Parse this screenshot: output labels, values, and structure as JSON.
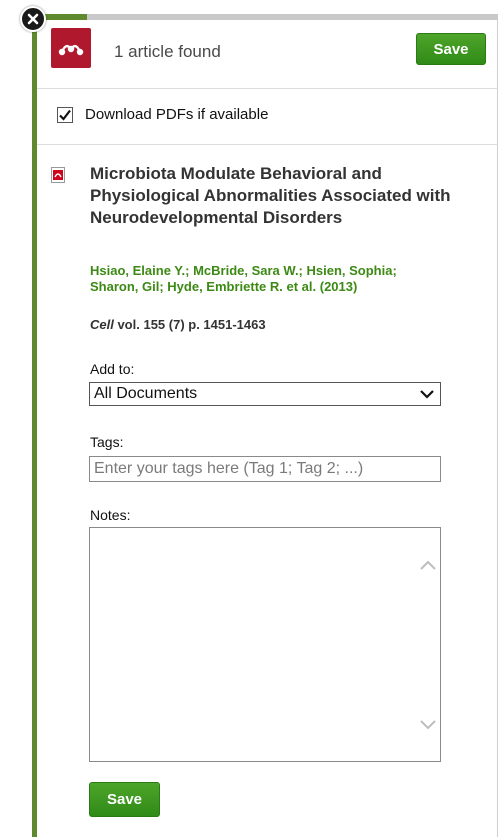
{
  "header": {
    "found_text": "1 article found",
    "save_label": "Save"
  },
  "options": {
    "download_pdfs_label": "Download PDFs if available",
    "download_pdfs_checked": true
  },
  "article": {
    "title": "Microbiota Modulate Behavioral and Physiological Abnormalities Associated with Neurodevelopmental Disorders",
    "authors": "Hsiao, Elaine Y.;  McBride, Sara W.;  Hsien, Sophia;  Sharon, Gil;  Hyde, Embriette R. et al.",
    "year": "(2013)",
    "journal": "Cell",
    "citation": " vol. 155 (7) p. 1451-1463"
  },
  "form": {
    "add_to_label": "Add to:",
    "add_to_value": "All Documents",
    "tags_label": "Tags:",
    "tags_placeholder": "Enter your tags here (Tag 1; Tag 2; ...)",
    "notes_label": "Notes:",
    "save_label": "Save"
  },
  "colors": {
    "brand": "#b0192d",
    "accent_green": "#3c8a14",
    "button_green": "#2f8a17"
  }
}
